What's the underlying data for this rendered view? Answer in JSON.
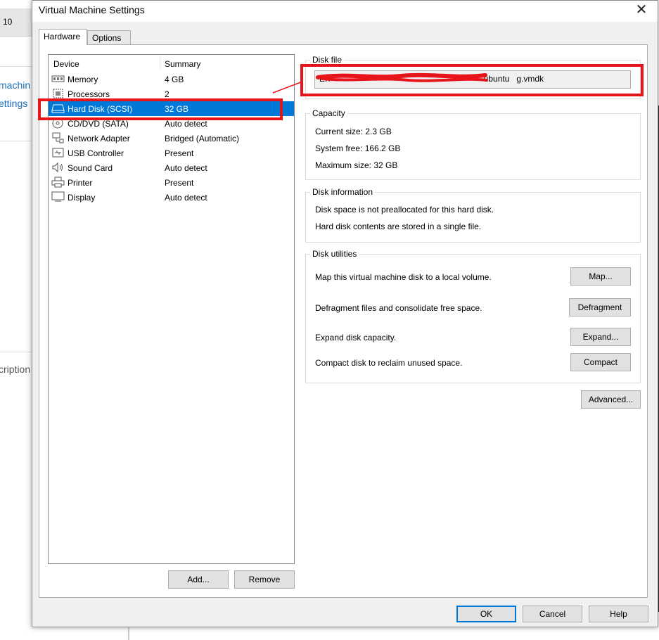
{
  "background": {
    "tab_number": "10",
    "link_1": "machin",
    "link_2": "ettings",
    "description_fragment": "cription"
  },
  "dialog": {
    "title": "Virtual Machine Settings",
    "close_glyph": "✕",
    "tabs": [
      {
        "label": "Hardware",
        "active": true
      },
      {
        "label": "Options",
        "active": false
      }
    ]
  },
  "device_list": {
    "headers": {
      "device": "Device",
      "summary": "Summary"
    },
    "items": [
      {
        "name": "Memory",
        "summary": "4 GB",
        "icon": "memory-icon"
      },
      {
        "name": "Processors",
        "summary": "2",
        "icon": "processor-icon"
      },
      {
        "name": "Hard Disk (SCSI)",
        "summary": "32 GB",
        "icon": "hard-disk-icon",
        "selected": true
      },
      {
        "name": "CD/DVD (SATA)",
        "summary": "Auto detect",
        "icon": "cd-dvd-icon"
      },
      {
        "name": "Network Adapter",
        "summary": "Bridged (Automatic)",
        "icon": "network-adapter-icon"
      },
      {
        "name": "USB Controller",
        "summary": "Present",
        "icon": "usb-icon"
      },
      {
        "name": "Sound Card",
        "summary": "Auto detect",
        "icon": "speaker-icon"
      },
      {
        "name": "Printer",
        "summary": "Present",
        "icon": "printer-icon"
      },
      {
        "name": "Display",
        "summary": "Auto detect",
        "icon": "monitor-icon"
      }
    ],
    "add_label": "Add...",
    "remove_label": "Remove"
  },
  "disk_file": {
    "label": "Disk file",
    "path_start": "E:\\",
    "path_end": "g.vmdk",
    "path_middle_fragment": "ubuntu"
  },
  "capacity": {
    "label": "Capacity",
    "current_size": "Current size: 2.3 GB",
    "system_free": "System free: 166.2 GB",
    "maximum_size": "Maximum size: 32 GB"
  },
  "disk_information": {
    "label": "Disk information",
    "line1": "Disk space is not preallocated for this hard disk.",
    "line2": "Hard disk contents are stored in a single file."
  },
  "disk_utilities": {
    "label": "Disk utilities",
    "map_text": "Map this virtual machine disk to a local volume.",
    "map_button": "Map...",
    "defrag_text": "Defragment files and consolidate free space.",
    "defrag_button": "Defragment",
    "expand_text": "Expand disk capacity.",
    "expand_button": "Expand...",
    "compact_text": "Compact disk to reclaim unused space.",
    "compact_button": "Compact"
  },
  "advanced_button": "Advanced...",
  "footer": {
    "ok": "OK",
    "cancel": "Cancel",
    "help": "Help"
  },
  "colors": {
    "selection": "#0078d7",
    "annotation_red": "#e8141b",
    "dialog_bg": "#f0f0f0"
  }
}
